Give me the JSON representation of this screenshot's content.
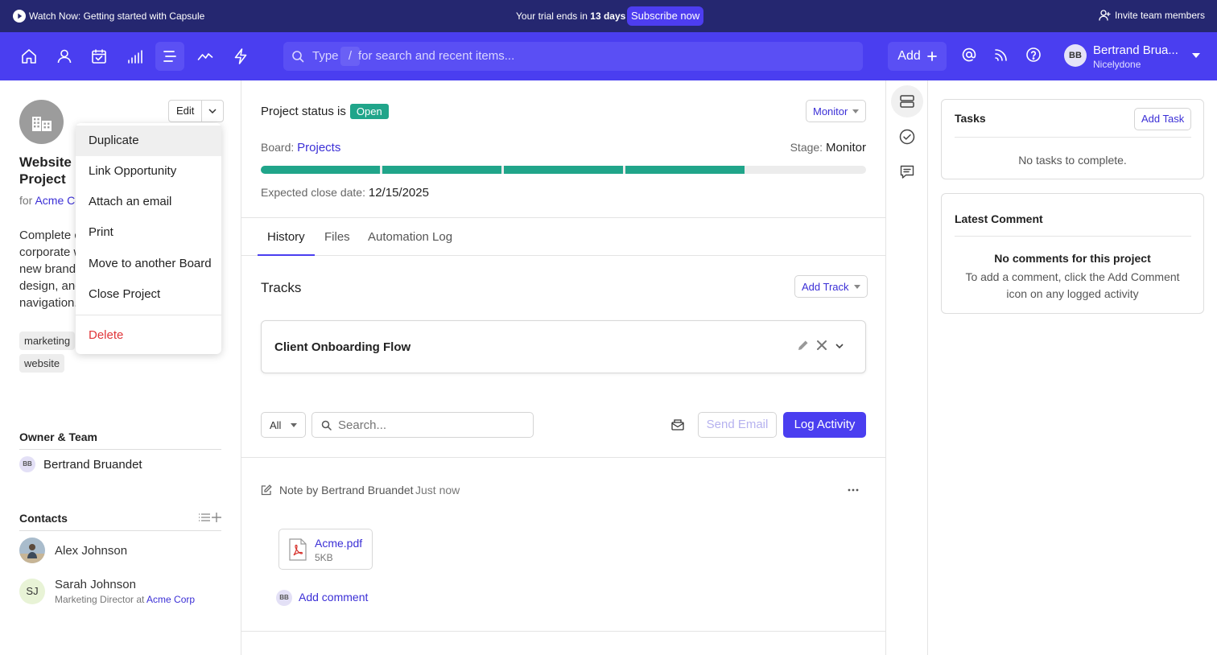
{
  "banner": {
    "watch_label": "Watch Now: Getting started with Capsule",
    "trial_prefix": "Your trial ends in",
    "trial_days": "13 days",
    "subscribe_label": "Subscribe now",
    "invite_label": "Invite team members"
  },
  "nav": {
    "icons": [
      "home-icon",
      "person-icon",
      "calendar-check-icon",
      "bar-chart-icon",
      "projects-icon",
      "trend-line-icon",
      "lightning-icon"
    ],
    "search": {
      "type_label": "Type",
      "key_hint": "/",
      "rest_label": "for search and recent items..."
    },
    "add_label": "Add",
    "user": {
      "initials": "BB",
      "name": "Bertrand Brua...",
      "company": "Nicelydone"
    }
  },
  "project": {
    "edit_label": "Edit",
    "title_line1": "Website F",
    "title_line2": "Project",
    "for_prefix": "for",
    "for_company": "Acme Co",
    "description": [
      "Complete c",
      "corporate w",
      "new brandi",
      "design, and",
      "navigation."
    ],
    "tags": [
      "marketing",
      "website"
    ],
    "owner_heading": "Owner & Team",
    "owner": {
      "initials": "BB",
      "name": "Bertrand Bruandet"
    },
    "contacts_heading": "Contacts",
    "contacts": [
      {
        "name": "Alex Johnson"
      },
      {
        "initials": "SJ",
        "name": "Sarah Johnson",
        "role_prefix": "Marketing Director at",
        "company": "Acme Corp"
      }
    ]
  },
  "menu": {
    "items": [
      "Duplicate",
      "Link Opportunity",
      "Attach an email",
      "Print",
      "Move to another Board",
      "Close Project"
    ],
    "delete_label": "Delete"
  },
  "status": {
    "prefix": "Project status is",
    "badge": "Open",
    "monitor_label": "Monitor",
    "board_prefix": "Board:",
    "board_name": "Projects",
    "stage_prefix": "Stage:",
    "stage_name": "Monitor",
    "progress": {
      "completed_segments": 4,
      "total_segments": 5
    },
    "close_prefix": "Expected close date:",
    "close_date": "12/15/2025"
  },
  "tabs": [
    "History",
    "Files",
    "Automation Log"
  ],
  "tracks": {
    "heading": "Tracks",
    "add_label": "Add Track",
    "items": [
      {
        "name": "Client Onboarding Flow"
      }
    ]
  },
  "activity": {
    "filter_label": "All",
    "search_placeholder": "Search...",
    "send_email_label": "Send Email",
    "log_activity_label": "Log Activity",
    "note": {
      "author": "Note by Bertrand Bruandet",
      "time": "Just now",
      "file": {
        "name": "Acme.pdf",
        "size": "5KB"
      },
      "comment_initials": "BB",
      "add_comment_label": "Add comment"
    }
  },
  "tasks": {
    "heading": "Tasks",
    "add_label": "Add Task",
    "empty": "No tasks to complete."
  },
  "latest_comment": {
    "heading": "Latest Comment",
    "empty_title": "No comments for this project",
    "empty_body_1": "To add a comment, click the Add Comment",
    "empty_body_2": "icon on any logged activity"
  },
  "colors": {
    "banner_bg": "#252770",
    "nav_bg": "#4a3ef0",
    "accent": "#3b2fd6",
    "progress": "#20a58a",
    "danger": "#e0363a"
  }
}
